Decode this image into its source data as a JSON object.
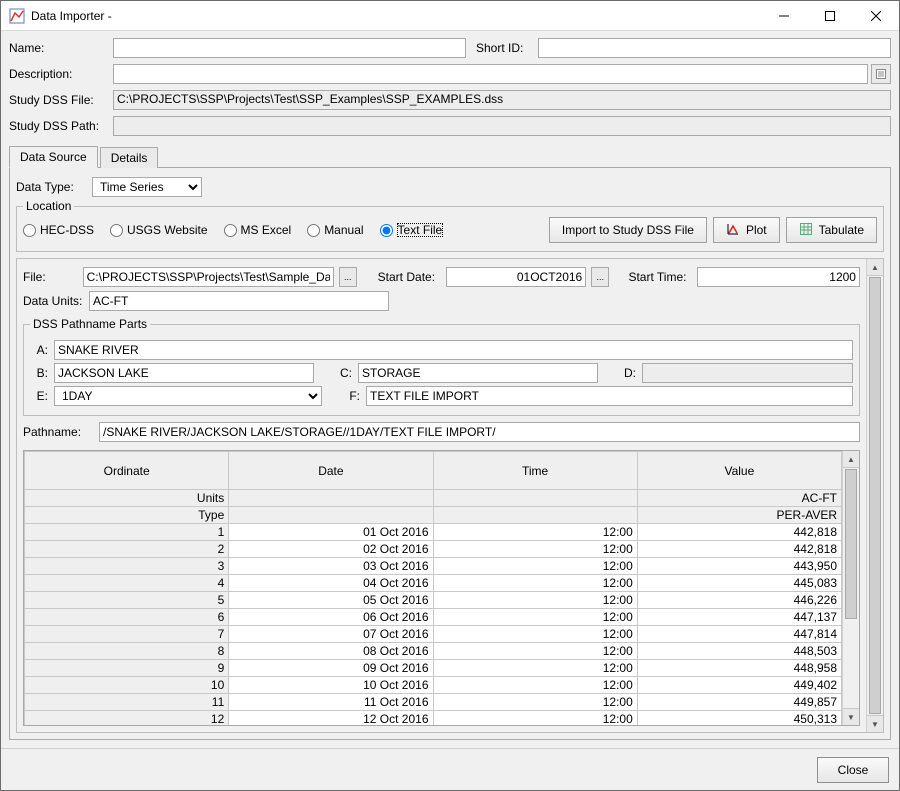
{
  "titlebar": {
    "title": "Data Importer -"
  },
  "labels": {
    "name": "Name:",
    "short_id": "Short ID:",
    "description": "Description:",
    "study_dss_file": "Study DSS File:",
    "study_dss_path": "Study DSS Path:",
    "data_type": "Data Type:",
    "file": "File:",
    "start_date": "Start Date:",
    "start_time": "Start Time:",
    "data_units": "Data Units:",
    "pathname": "Pathname:"
  },
  "fields": {
    "name": "",
    "short_id": "",
    "description": "",
    "study_dss_file": "C:\\PROJECTS\\SSP\\Projects\\Test\\SSP_Examples\\SSP_EXAMPLES.dss",
    "study_dss_path": "",
    "data_type": "Time Series",
    "file": "C:\\PROJECTS\\SSP\\Projects\\Test\\Sample_Data_text.txt",
    "start_date": "01OCT2016",
    "start_time": "1200",
    "data_units": "AC-FT",
    "pathname": "/SNAKE RIVER/JACKSON LAKE/STORAGE//1DAY/TEXT FILE IMPORT/"
  },
  "tabs": {
    "data_source": "Data Source",
    "details": "Details"
  },
  "location": {
    "legend": "Location",
    "hec_dss": "HEC-DSS",
    "usgs": "USGS Website",
    "ms_excel": "MS Excel",
    "manual": "Manual",
    "text_file": "Text File",
    "selected": "text_file"
  },
  "buttons": {
    "import": "Import to Study DSS File",
    "plot": "Plot",
    "tabulate": "Tabulate",
    "close": "Close",
    "browse": "..."
  },
  "path_parts": {
    "legend": "DSS Pathname Parts",
    "A": "SNAKE RIVER",
    "B": "JACKSON LAKE",
    "C": "STORAGE",
    "D": "",
    "E": "1DAY",
    "F": "TEXT FILE IMPORT"
  },
  "table": {
    "headers": {
      "ordinate": "Ordinate",
      "date": "Date",
      "time": "Time",
      "value": "Value"
    },
    "meta": {
      "units_label": "Units",
      "units_value": "AC-FT",
      "type_label": "Type",
      "type_value": "PER-AVER"
    },
    "rows": [
      {
        "ord": "1",
        "date": "01 Oct 2016",
        "time": "12:00",
        "value": "442,818"
      },
      {
        "ord": "2",
        "date": "02 Oct 2016",
        "time": "12:00",
        "value": "442,818"
      },
      {
        "ord": "3",
        "date": "03 Oct 2016",
        "time": "12:00",
        "value": "443,950"
      },
      {
        "ord": "4",
        "date": "04 Oct 2016",
        "time": "12:00",
        "value": "445,083"
      },
      {
        "ord": "5",
        "date": "05 Oct 2016",
        "time": "12:00",
        "value": "446,226"
      },
      {
        "ord": "6",
        "date": "06 Oct 2016",
        "time": "12:00",
        "value": "447,137"
      },
      {
        "ord": "7",
        "date": "07 Oct 2016",
        "time": "12:00",
        "value": "447,814"
      },
      {
        "ord": "8",
        "date": "08 Oct 2016",
        "time": "12:00",
        "value": "448,503"
      },
      {
        "ord": "9",
        "date": "09 Oct 2016",
        "time": "12:00",
        "value": "448,958"
      },
      {
        "ord": "10",
        "date": "10 Oct 2016",
        "time": "12:00",
        "value": "449,402"
      },
      {
        "ord": "11",
        "date": "11 Oct 2016",
        "time": "12:00",
        "value": "449,857"
      },
      {
        "ord": "12",
        "date": "12 Oct 2016",
        "time": "12:00",
        "value": "450,313"
      }
    ]
  }
}
